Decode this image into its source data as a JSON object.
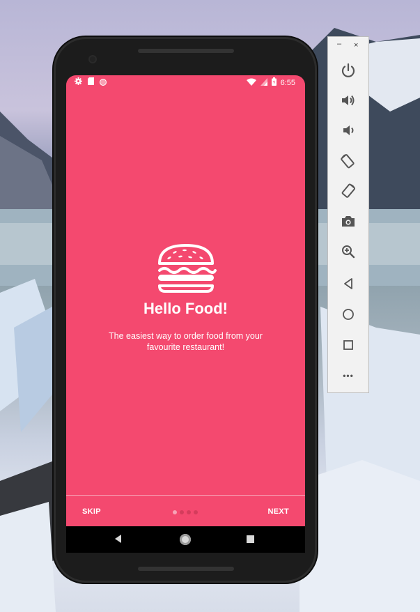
{
  "status_bar": {
    "time": "6:55",
    "left_icons": [
      "gear-icon",
      "sdcard-icon",
      "circle-notification-icon"
    ],
    "right_icons": [
      "wifi-icon",
      "signal-icon",
      "battery-icon"
    ]
  },
  "onboarding": {
    "illustration": "burger-icon",
    "title": "Hello Food!",
    "subtitle": "The easiest way to order food from your favourite restaurant!",
    "skip_label": "SKIP",
    "next_label": "NEXT",
    "page_count": 4,
    "active_page": 1
  },
  "nav_bar": {
    "icons": [
      "back-icon",
      "home-icon",
      "recents-icon"
    ]
  },
  "emulator_panel": {
    "minimize": "–",
    "close": "×",
    "buttons": [
      "power-icon",
      "volume-up-icon",
      "volume-down-icon",
      "rotate-left-icon",
      "rotate-right-icon",
      "camera-icon",
      "zoom-icon",
      "back-icon",
      "home-icon",
      "overview-icon",
      "more-icon"
    ],
    "more_label": "•••"
  },
  "colors": {
    "accent": "#f4496f",
    "dot_inactive": "#d43c5c",
    "dot_active": "#f7a3b6"
  }
}
